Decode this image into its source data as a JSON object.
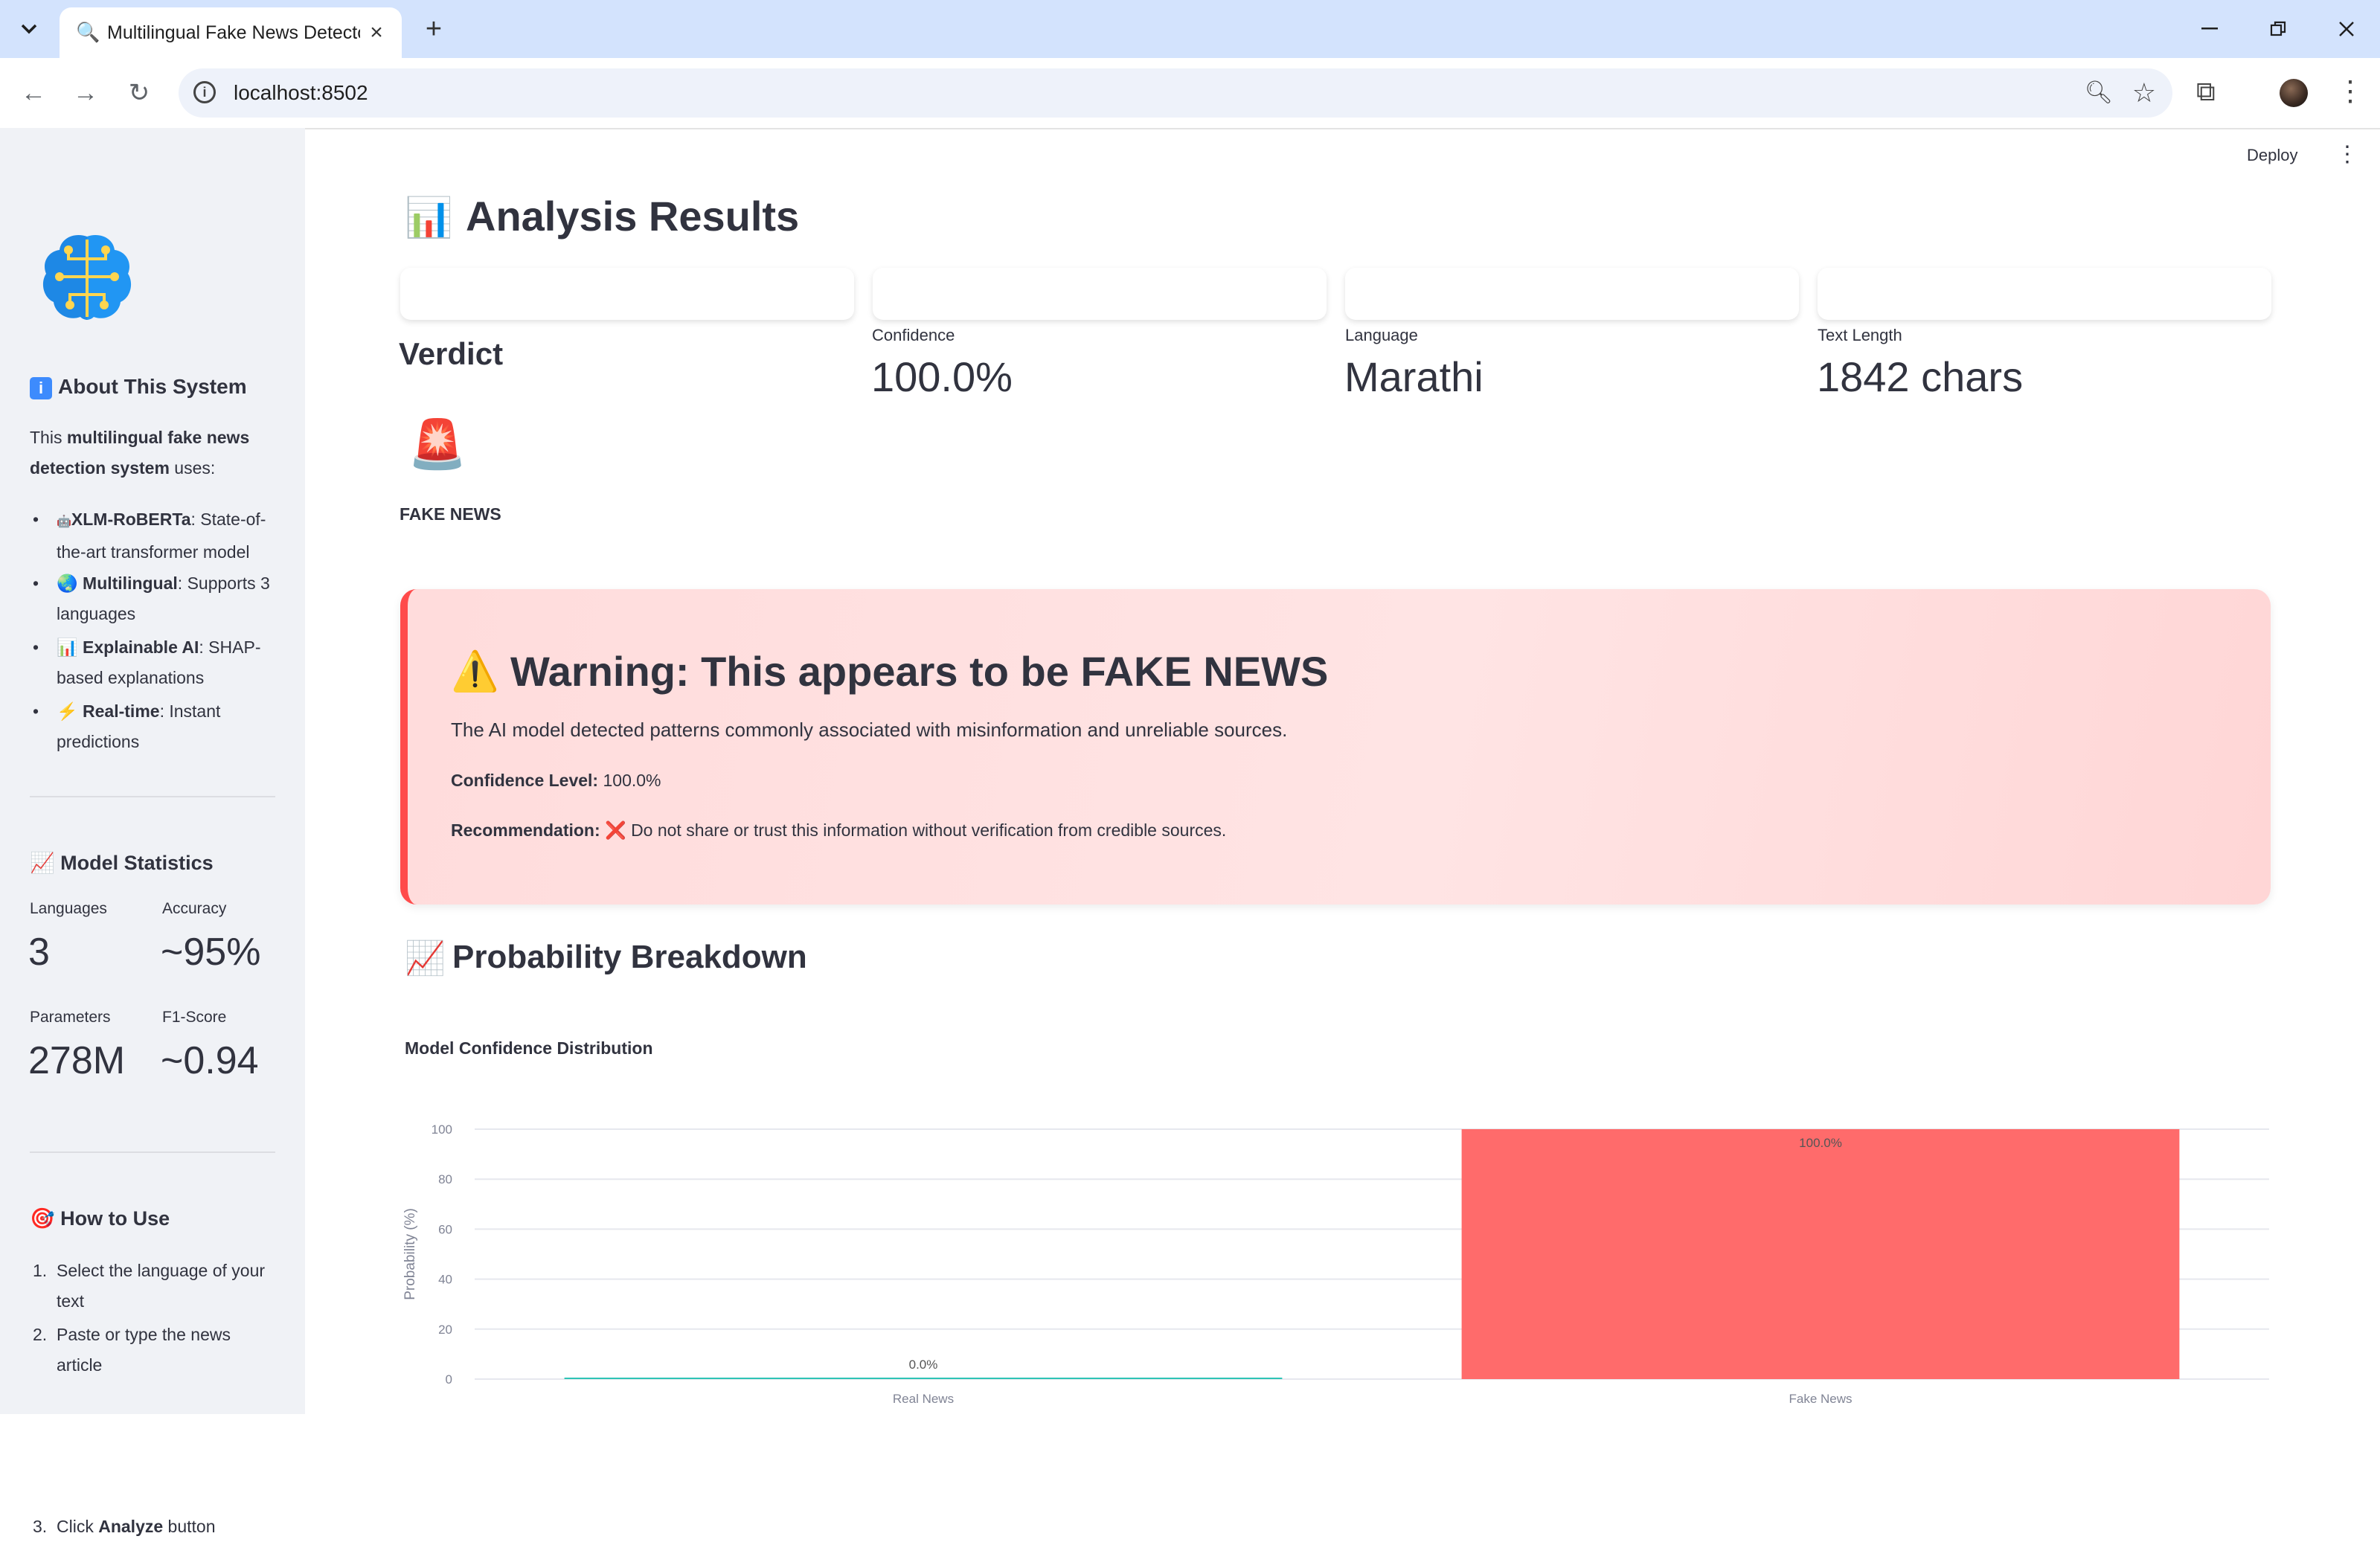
{
  "browser": {
    "tab_title": "Multilingual Fake News Detector",
    "url": "localhost:8502"
  },
  "sidebar": {
    "about": {
      "heading": "About This System",
      "intro_prefix": "This ",
      "intro_bold": "multilingual fake news detection system",
      "intro_suffix": " uses:",
      "features": [
        {
          "icon": "🤖",
          "name": "XLM-RoBERTa",
          "desc": ": State-of-the-art transformer model"
        },
        {
          "icon": "🌏",
          "name": "Multilingual",
          "desc": ": Supports 3 languages"
        },
        {
          "icon": "📊",
          "name": "Explainable AI",
          "desc": ": SHAP-based explanations"
        },
        {
          "icon": "⚡",
          "name": "Real-time",
          "desc": ": Instant predictions"
        }
      ]
    },
    "stats": {
      "heading": "Model Statistics",
      "items": [
        {
          "label": "Languages",
          "value": "3"
        },
        {
          "label": "Accuracy",
          "value": "~95%"
        },
        {
          "label": "Parameters",
          "value": "278M"
        },
        {
          "label": "F1-Score",
          "value": "~0.94"
        }
      ]
    },
    "how_to": {
      "heading": "How to Use",
      "steps": [
        {
          "n": "1.",
          "text": "Select the language of your text"
        },
        {
          "n": "2.",
          "text": "Paste or type the news article"
        },
        {
          "n": "3.",
          "text_prefix": "Click ",
          "text_bold": "Analyze",
          "text_suffix": " button"
        }
      ]
    }
  },
  "header": {
    "deploy_label": "Deploy"
  },
  "main": {
    "results_title": "Analysis Results",
    "metrics": [
      {
        "label": "Confidence",
        "value": "100.0%"
      },
      {
        "label": "Language",
        "value": "Marathi"
      },
      {
        "label": "Text Length",
        "value": "1842 chars"
      }
    ],
    "verdict": {
      "title": "Verdict",
      "icon": "🚨",
      "text": "FAKE NEWS"
    },
    "warning": {
      "icon": "⚠️",
      "title": "Warning: This appears to be FAKE NEWS",
      "description": "The AI model detected patterns commonly associated with misinformation and unreliable sources.",
      "confidence_label": "Confidence Level:",
      "confidence_value": "100.0%",
      "recommendation_label": "Recommendation:",
      "recommendation_icon": "❌",
      "recommendation_text": "Do not share or trust this information without verification from credible sources."
    },
    "probability_title": "Probability Breakdown",
    "chart_title": "Model Confidence Distribution"
  },
  "chart_data": {
    "type": "bar",
    "title": "Model Confidence Distribution",
    "categories": [
      "Real News",
      "Fake News"
    ],
    "values": [
      0.0,
      100.0
    ],
    "labels": [
      "0.0%",
      "100.0%"
    ],
    "colors": [
      "#2ec4b6",
      "#ff6b6b"
    ],
    "xlabel": "",
    "ylabel": "Probability (%)",
    "ylim": [
      0,
      100
    ],
    "yticks": [
      0,
      20,
      40,
      60,
      80,
      100
    ],
    "grid": true
  }
}
